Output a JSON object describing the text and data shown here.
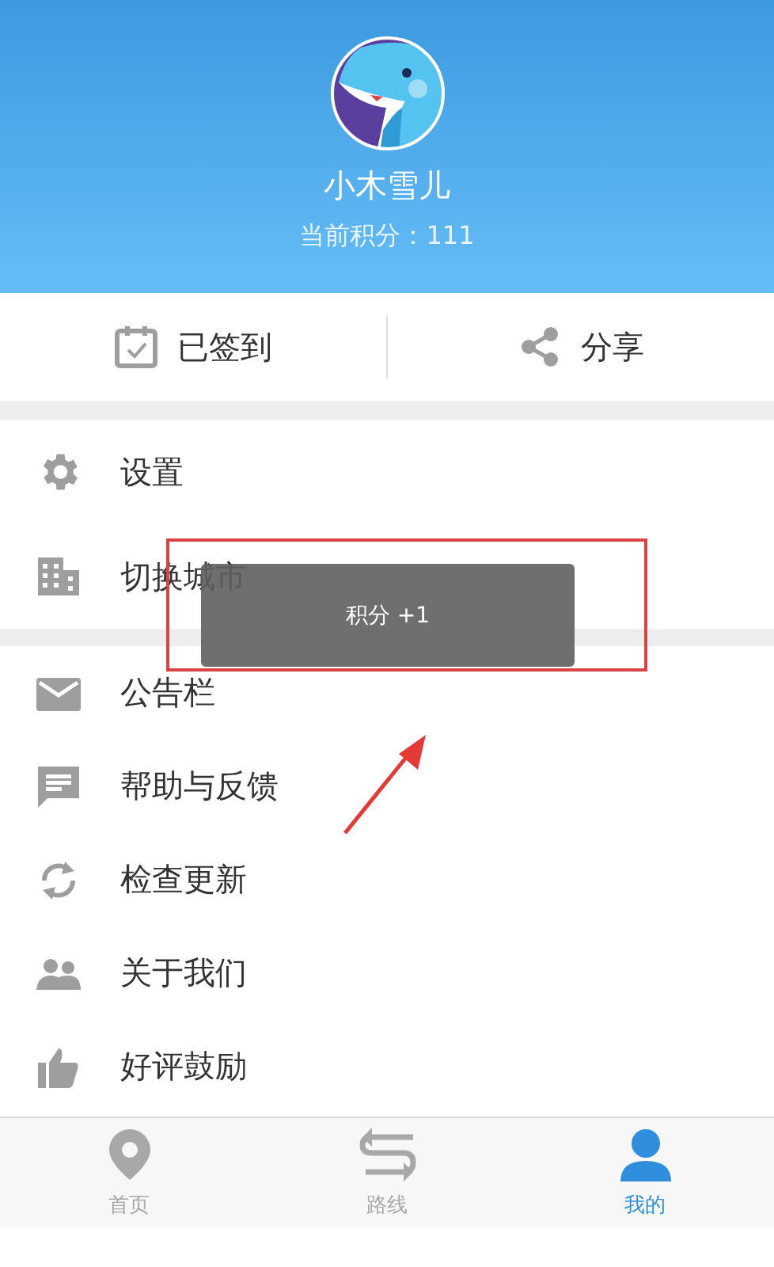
{
  "profile": {
    "name": "小木雪儿",
    "points": "当前积分：111"
  },
  "actions": [
    {
      "label": "已签到",
      "kind": "checkin"
    },
    {
      "label": "分享",
      "kind": "share"
    }
  ],
  "menu_groups": [
    [
      {
        "label": "设置"
      },
      {
        "label": "切换城市"
      }
    ],
    [
      {
        "label": "公告栏"
      },
      {
        "label": "帮助与反馈"
      },
      {
        "label": "检查更新"
      },
      {
        "label": "关于我们"
      },
      {
        "label": "好评鼓励"
      }
    ]
  ],
  "toast": "积分 +1",
  "bottom_nav": [
    {
      "label": "首页",
      "selected": false
    },
    {
      "label": "路线",
      "selected": false
    },
    {
      "label": "我的",
      "selected": true
    }
  ]
}
